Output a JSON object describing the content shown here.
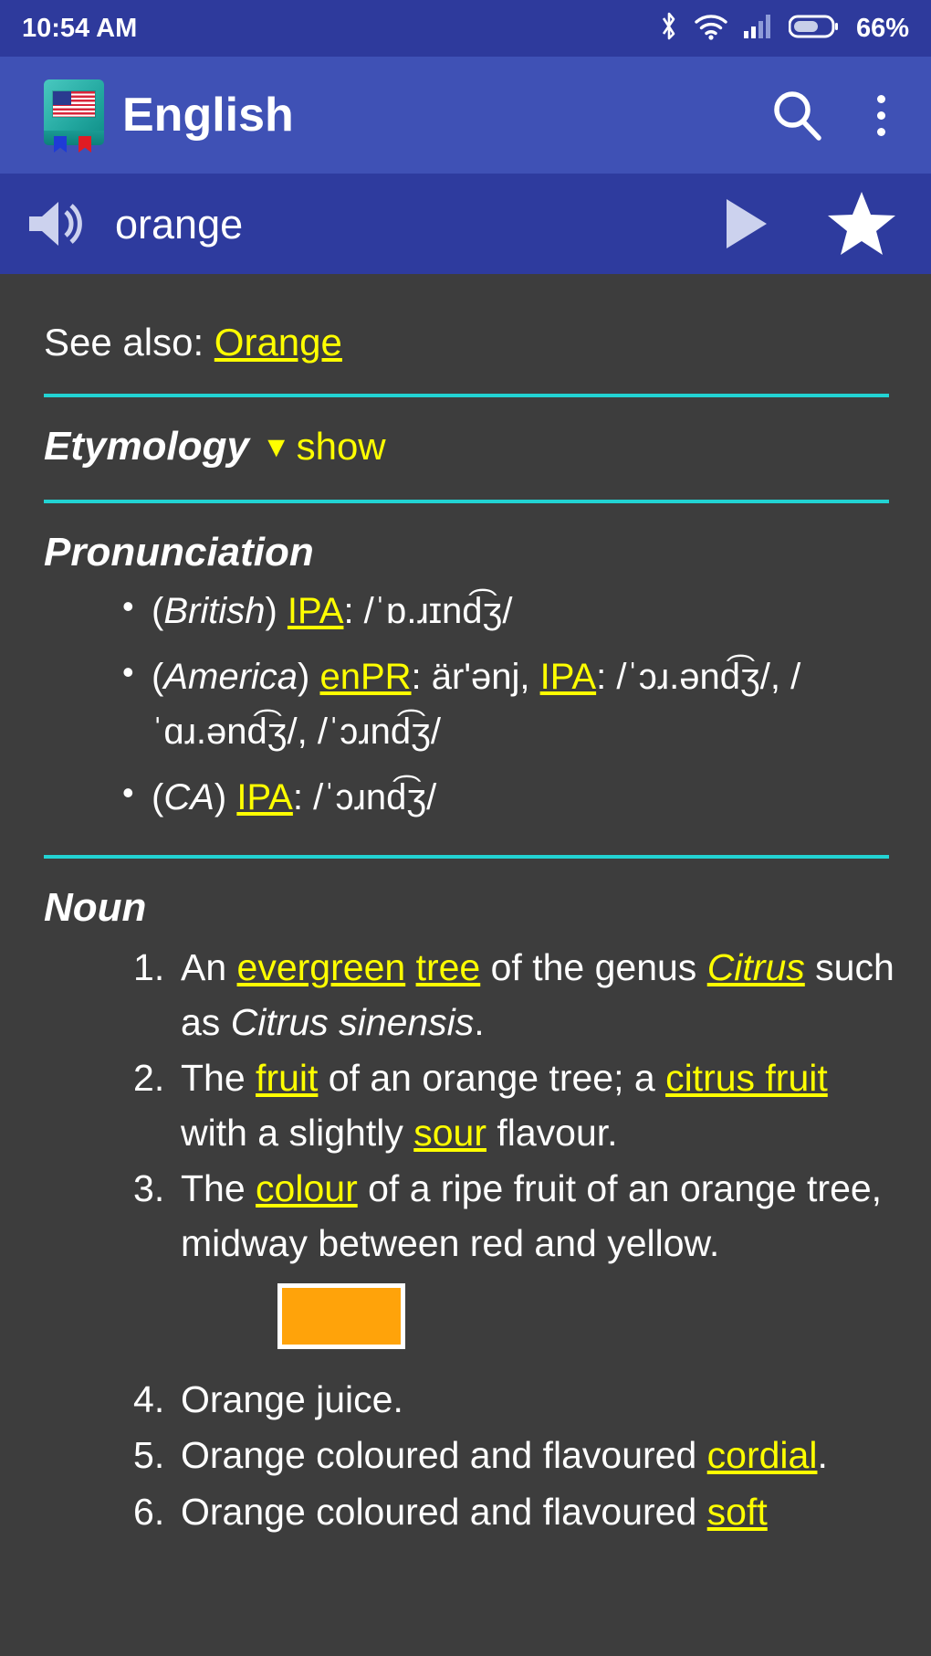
{
  "status_bar": {
    "time": "10:54 AM",
    "battery_percent": "66%",
    "icons": [
      "bluetooth-icon",
      "wifi-icon",
      "cellular-signal-icon",
      "battery-icon"
    ]
  },
  "app_bar": {
    "title": "English",
    "app_icon": "dictionary-book-us-flag-icon",
    "search_icon": "search-icon",
    "overflow_icon": "overflow-menu-icon"
  },
  "word_bar": {
    "speaker_icon": "speaker-icon",
    "word": "orange",
    "play_icon": "play-icon",
    "favorite_icon": "star-icon"
  },
  "content": {
    "see_also": {
      "label": "See also:",
      "link": "Orange"
    },
    "etymology": {
      "heading": "Etymology",
      "caret": "▼",
      "toggle": "show"
    },
    "pronunciation": {
      "heading": "Pronunciation",
      "entries": [
        {
          "region_open": "(",
          "region": "British",
          "region_close": ")",
          "notation": "IPA",
          "sep": ": ",
          "value": "/ˈɒ.ɹɪnd͡ʒ/"
        },
        {
          "region_open": "(",
          "region": "America",
          "region_close": ")",
          "notation": "enPR",
          "sep": ": ",
          "value": "är'ənj, ",
          "notation2": "IPA",
          "sep2": ": ",
          "value2": "/ˈɔɹ.ənd͡ʒ/, /ˈɑɹ.ənd͡ʒ/, /ˈɔɹnd͡ʒ/"
        },
        {
          "region_open": "(",
          "region": "CA",
          "region_close": ")",
          "notation": "IPA",
          "sep": ": ",
          "value": "/ˈɔɹnd͡ʒ/"
        }
      ]
    },
    "noun": {
      "heading": "Noun",
      "definitions": [
        {
          "p1": "An ",
          "l1": "evergreen",
          "p2": " ",
          "l2": "tree",
          "p3": " of the genus ",
          "l3": "Citrus",
          "p4": " such as ",
          "i1": "Citrus sinensis",
          "p5": "."
        },
        {
          "p1": "The ",
          "l1": "fruit",
          "p2": " of an orange tree; a ",
          "l2": "citrus fruit",
          "p3": " with a slightly ",
          "l3": "sour",
          "p4": " flavour."
        },
        {
          "p1": "The ",
          "l1": "colour",
          "p2": " of a ripe fruit of an orange tree, midway between red and yellow."
        },
        {
          "p1": "Orange juice."
        },
        {
          "p1": "Orange coloured and flavoured ",
          "l1": "cordial",
          "p2": "."
        },
        {
          "p1": "Orange coloured and flavoured ",
          "l1": "soft"
        }
      ]
    }
  },
  "colors": {
    "status_bar": "#2e3a9c",
    "app_bar": "#3f51b5",
    "word_bar": "#2e3b9e",
    "content_bg": "#3d3d3d",
    "divider": "#22d3d3",
    "link": "#ffff00",
    "swatch": "#ffa30a"
  }
}
